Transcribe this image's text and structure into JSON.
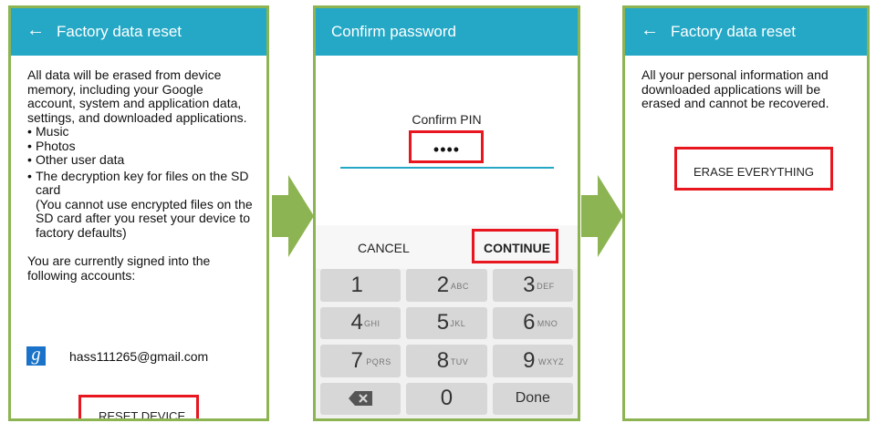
{
  "screen1": {
    "title": "Factory data reset",
    "intro": "All data will be erased from device memory, including your Google account, system and application data, settings, and downloaded applications.",
    "bullets": [
      "Music",
      "Photos",
      "Other user data",
      "The decryption key for files on the SD card"
    ],
    "note": "(You cannot use encrypted files on the SD card after you reset your device to factory defaults)",
    "signed_in_text": "You are currently signed into the following accounts:",
    "account_email": "hass111265@gmail.com",
    "reset_button": "RESET DEVICE"
  },
  "screen2": {
    "title": "Confirm password",
    "pin_label": "Confirm PIN",
    "pin_value": "••••",
    "cancel": "CANCEL",
    "continue": "CONTINUE",
    "keys": [
      {
        "digit": "1",
        "letters": ""
      },
      {
        "digit": "2",
        "letters": "ABC"
      },
      {
        "digit": "3",
        "letters": "DEF"
      },
      {
        "digit": "4",
        "letters": "GHI"
      },
      {
        "digit": "5",
        "letters": "JKL"
      },
      {
        "digit": "6",
        "letters": "MNO"
      },
      {
        "digit": "7",
        "letters": "PQRS"
      },
      {
        "digit": "8",
        "letters": "TUV"
      },
      {
        "digit": "9",
        "letters": "WXYZ"
      }
    ],
    "zero": "0",
    "done": "Done"
  },
  "screen3": {
    "title": "Factory data reset",
    "text": "All your personal information and downloaded applications will be erased and cannot be recovered.",
    "erase_button": "ERASE EVERYTHING"
  },
  "colors": {
    "topbar": "#24a8c6",
    "highlight": "#e8161f",
    "border": "#8db452"
  }
}
